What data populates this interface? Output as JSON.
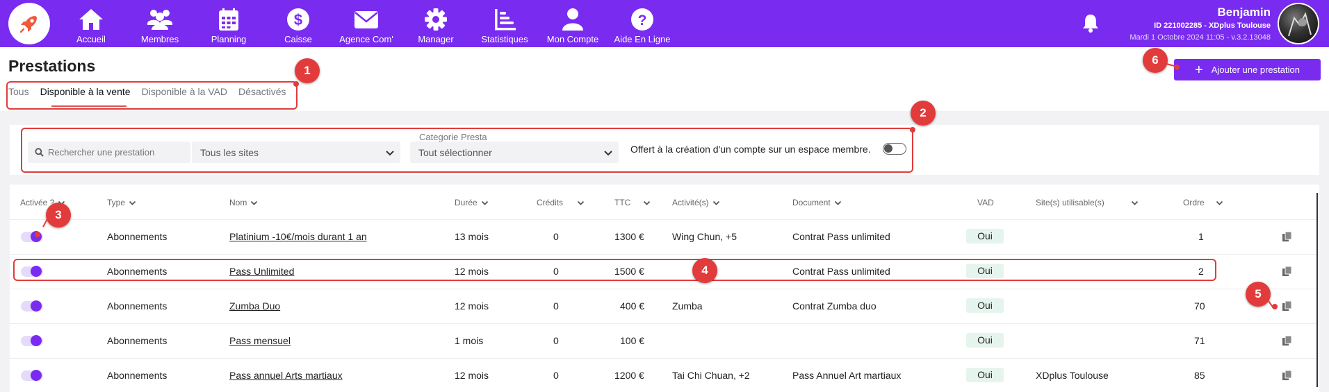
{
  "nav": {
    "items": [
      {
        "label": "Accueil",
        "icon": "home-icon"
      },
      {
        "label": "Membres",
        "icon": "members-icon"
      },
      {
        "label": "Planning",
        "icon": "calendar-icon"
      },
      {
        "label": "Caisse",
        "icon": "dollar-icon"
      },
      {
        "label": "Agence Com'",
        "icon": "mail-icon"
      },
      {
        "label": "Manager",
        "icon": "gear-icon"
      },
      {
        "label": "Statistiques",
        "icon": "stats-icon"
      },
      {
        "label": "Mon Compte",
        "icon": "user-icon"
      },
      {
        "label": "Aide En Ligne",
        "icon": "help-icon"
      }
    ]
  },
  "user": {
    "name": "Benjamin",
    "id_line": "ID 221002285 - XDplus Toulouse",
    "date_line": "Mardi 1 Octobre 2024 11:05 - v.3.2.13048"
  },
  "page": {
    "title": "Prestations",
    "add_button": "Ajouter une prestation",
    "tabs": [
      "Tous",
      "Disponible à la vente",
      "Disponible à la VAD",
      "Désactivés"
    ],
    "active_tab": "Disponible à la vente"
  },
  "filters": {
    "search_placeholder": "Rechercher une prestation",
    "sites_value": "Tous les sites",
    "category_label": "Categorie Presta",
    "category_value": "Tout sélectionner",
    "offert_label": "Offert à la création d'un compte sur un espace membre.",
    "offert_toggle": false
  },
  "table": {
    "headers": {
      "active": "Activée ?",
      "type": "Type",
      "name": "Nom",
      "duration": "Durée",
      "credits": "Crédits",
      "ttc": "TTC",
      "activities": "Activité(s)",
      "document": "Document",
      "vad": "VAD",
      "sites": "Site(s) utilisable(s)",
      "order": "Ordre"
    },
    "rows": [
      {
        "active": true,
        "type": "Abonnements",
        "name": "Platinium -10€/mois durant 1 an",
        "duration": "13 mois",
        "credits": "0",
        "ttc": "1300 €",
        "activities": "Wing Chun, +5",
        "document": "Contrat Pass unlimited",
        "vad": "Oui",
        "sites": "",
        "order": "1"
      },
      {
        "active": true,
        "type": "Abonnements",
        "name": "Pass Unlimited",
        "duration": "12 mois",
        "credits": "0",
        "ttc": "1500 €",
        "activities": "",
        "document": "Contrat Pass unlimited",
        "vad": "Oui",
        "sites": "",
        "order": "2"
      },
      {
        "active": true,
        "type": "Abonnements",
        "name": "Zumba Duo",
        "duration": "12 mois",
        "credits": "0",
        "ttc": "400 €",
        "activities": "Zumba",
        "document": "Contrat Zumba duo",
        "vad": "Oui",
        "sites": "",
        "order": "70"
      },
      {
        "active": true,
        "type": "Abonnements",
        "name": "Pass mensuel",
        "duration": "1 mois",
        "credits": "0",
        "ttc": "100 €",
        "activities": "",
        "document": "",
        "vad": "Oui",
        "sites": "",
        "order": "71"
      },
      {
        "active": true,
        "type": "Abonnements",
        "name": "Pass annuel Arts martiaux",
        "duration": "12 mois",
        "credits": "0",
        "ttc": "1200 €",
        "activities": "Tai Chi Chuan, +2",
        "document": "Pass Annuel Art martiaux",
        "vad": "Oui",
        "sites": "XDplus Toulouse",
        "order": "85"
      }
    ]
  },
  "annotations": [
    "1",
    "2",
    "3",
    "4",
    "5",
    "6"
  ],
  "colors": {
    "brand": "#7a2bf0",
    "annotation": "#e23b3b",
    "vad_badge": "#e6f4ee"
  }
}
